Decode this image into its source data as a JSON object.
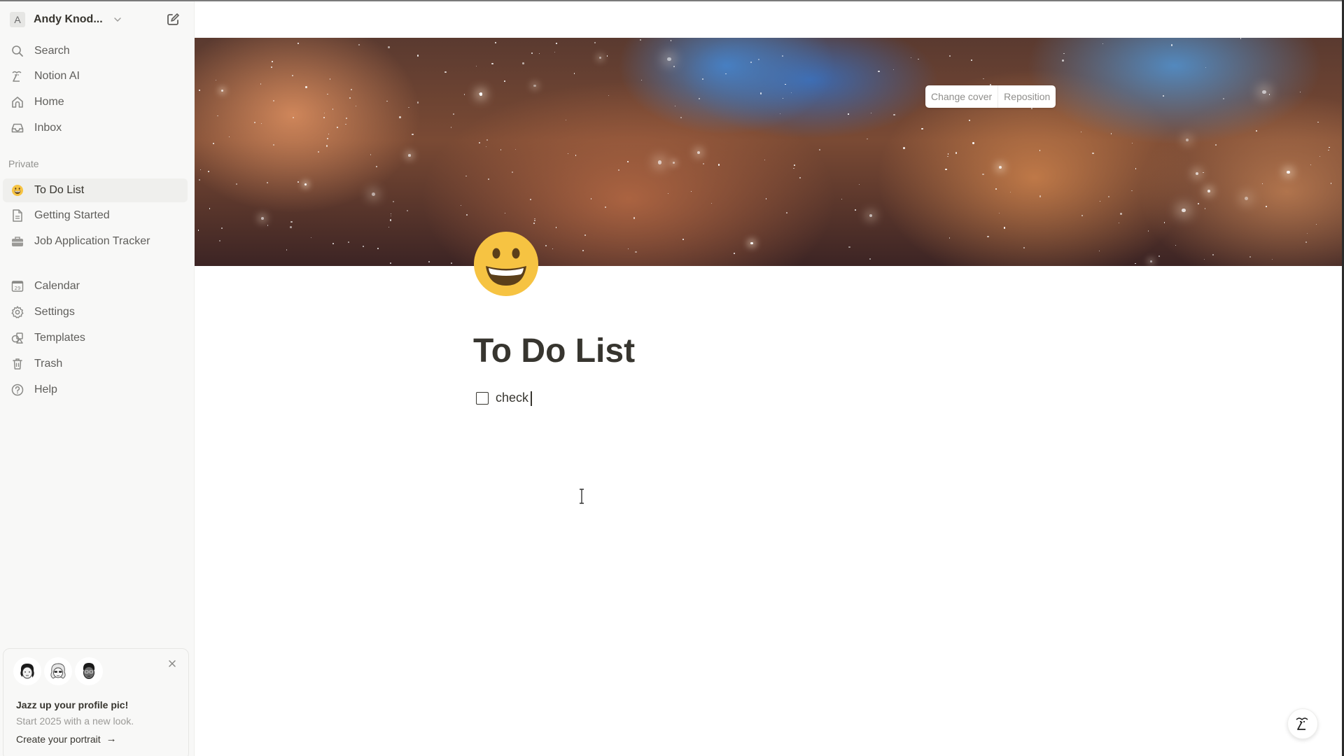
{
  "sidebar": {
    "workspace": {
      "avatar_letter": "A",
      "name": "Andy Knod..."
    },
    "top_items": [
      {
        "label": "Search",
        "icon": "search-icon"
      },
      {
        "label": "Notion AI",
        "icon": "notion-ai-icon"
      },
      {
        "label": "Home",
        "icon": "home-icon"
      },
      {
        "label": "Inbox",
        "icon": "inbox-icon"
      }
    ],
    "section_label": "Private",
    "pages": [
      {
        "label": "To Do List",
        "icon": "smiley-emoji-icon",
        "selected": true
      },
      {
        "label": "Getting Started",
        "icon": "document-icon",
        "selected": false
      },
      {
        "label": "Job Application Tracker",
        "icon": "briefcase-icon",
        "selected": false
      }
    ],
    "bottom_items": [
      {
        "label": "Calendar",
        "icon": "calendar-icon",
        "calendar_day": "29"
      },
      {
        "label": "Settings",
        "icon": "gear-icon"
      },
      {
        "label": "Templates",
        "icon": "templates-icon"
      },
      {
        "label": "Trash",
        "icon": "trash-icon"
      },
      {
        "label": "Help",
        "icon": "help-icon"
      }
    ],
    "promo": {
      "title": "Jazz up your profile pic!",
      "subtitle": "Start 2025 with a new look.",
      "link_label": "Create your portrait",
      "link_arrow": "→"
    }
  },
  "main": {
    "cover": {
      "change_label": "Change cover",
      "reposition_label": "Reposition"
    },
    "page": {
      "icon": "😃",
      "title": "To Do List",
      "todos": [
        {
          "text": "check",
          "checked": false
        }
      ]
    }
  },
  "colors": {
    "sidebar_bg": "#f8f8f7",
    "text_primary": "#37352f",
    "text_secondary": "#5f5e5b",
    "selected_bg": "#efefed",
    "emoji_yellow": "#f6c342"
  }
}
